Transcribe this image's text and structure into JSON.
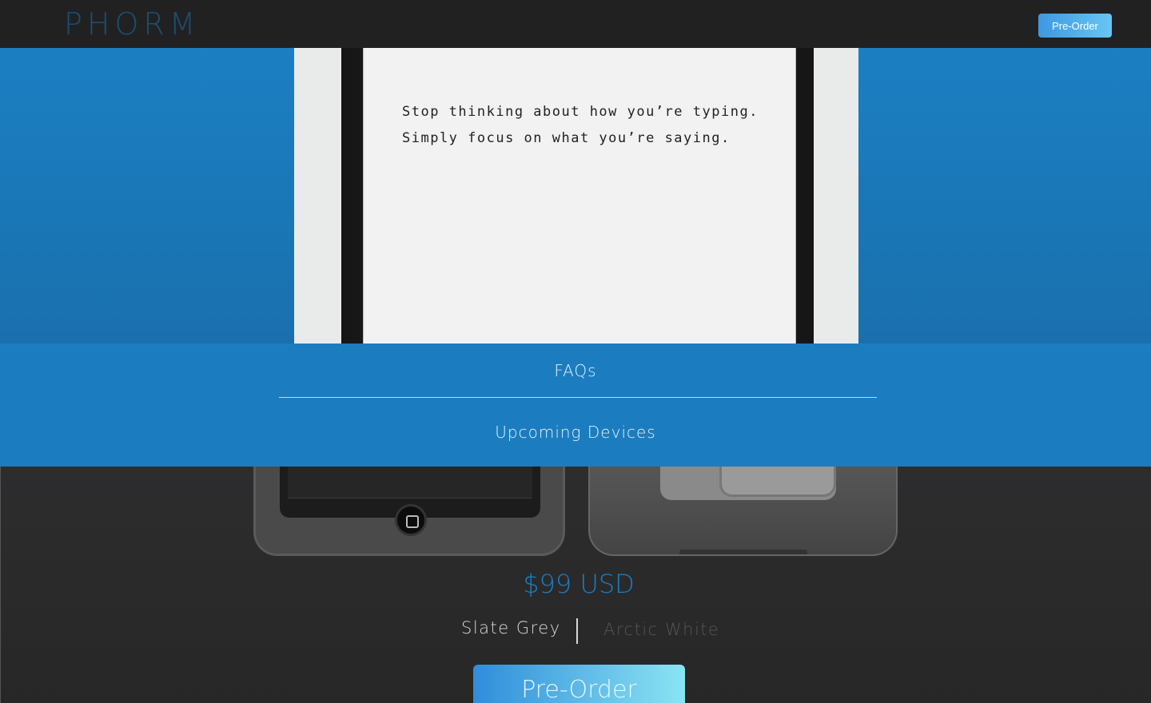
{
  "header": {
    "logo": "PHORM",
    "preorder_label": "Pre-Order"
  },
  "hero": {
    "line1": "Stop thinking about how you’re typing.",
    "line2": "Simply focus on what you’re saying."
  },
  "menu": {
    "items": [
      {
        "label": "FAQs"
      },
      {
        "label": "Upcoming Devices"
      }
    ]
  },
  "product": {
    "price": "$99 USD",
    "colors": [
      {
        "label": "Slate Grey",
        "selected": true
      },
      {
        "label": "Arctic White",
        "selected": false
      }
    ],
    "preorder_label": "Pre-Order"
  },
  "colors": {
    "accent": "#1b7dc0",
    "header_bg": "#222122",
    "product_bg": "#2b2b2c"
  }
}
